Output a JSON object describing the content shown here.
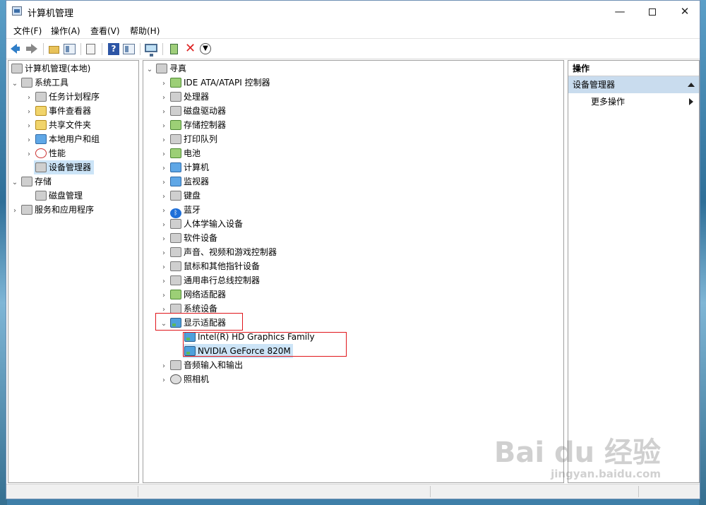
{
  "window": {
    "title": "计算机管理",
    "minimize_label": "—",
    "close_label": "✕"
  },
  "menu": [
    "文件(F)",
    "操作(A)",
    "查看(V)",
    "帮助(H)"
  ],
  "left_tree": {
    "root": "计算机管理(本地)",
    "system_tools": "系统工具",
    "task_scheduler": "任务计划程序",
    "event_viewer": "事件查看器",
    "shared_folders": "共享文件夹",
    "local_users": "本地用户和组",
    "performance": "性能",
    "device_manager": "设备管理器",
    "storage": "存储",
    "disk_management": "磁盘管理",
    "services_apps": "服务和应用程序"
  },
  "device_tree": {
    "root": "寻真",
    "categories": [
      "IDE ATA/ATAPI 控制器",
      "处理器",
      "磁盘驱动器",
      "存储控制器",
      "打印队列",
      "电池",
      "计算机",
      "监视器",
      "键盘",
      "蓝牙",
      "人体学输入设备",
      "软件设备",
      "声音、视频和游戏控制器",
      "鼠标和其他指针设备",
      "通用串行总线控制器",
      "网络适配器",
      "系统设备"
    ],
    "display_adapters": "显示适配器",
    "adapters": [
      "Intel(R) HD Graphics Family",
      "NVIDIA GeForce 820M"
    ],
    "after": [
      "音频输入和输出",
      "照相机"
    ]
  },
  "actions": {
    "header": "操作",
    "section": "设备管理器",
    "more": "更多操作"
  },
  "watermark": {
    "brand": "Bai du 经验",
    "url": "jingyan.baidu.com"
  }
}
